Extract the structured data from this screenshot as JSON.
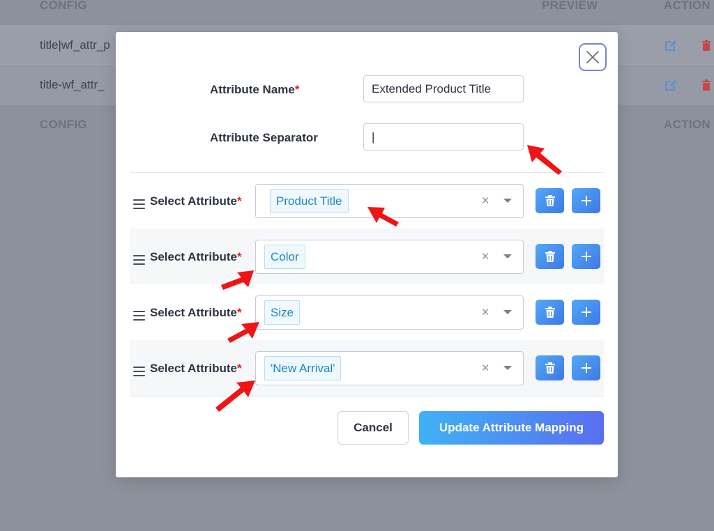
{
  "background_table": {
    "headers": {
      "config": "CONFIG",
      "preview": "PREVIEW",
      "action": "ACTION"
    },
    "rows": [
      {
        "config": "title|wf_attr_p"
      },
      {
        "config": "title-wf_attr_"
      }
    ],
    "footer": {
      "config": "CONFIG",
      "action": "ACTION"
    }
  },
  "modal": {
    "attribute_name": {
      "label": "Attribute Name",
      "required_mark": "*",
      "value": "Extended Product Title"
    },
    "attribute_separator": {
      "label": "Attribute Separator",
      "value": "|"
    },
    "attribute_rows": [
      {
        "label": "Select Attribute",
        "required_mark": "*",
        "selected": "Product Title"
      },
      {
        "label": "Select Attribute",
        "required_mark": "*",
        "selected": "Color"
      },
      {
        "label": "Select Attribute",
        "required_mark": "*",
        "selected": "Size"
      },
      {
        "label": "Select Attribute",
        "required_mark": "*",
        "selected": "'New Arrival'"
      }
    ],
    "clear_glyph": "×",
    "cancel_label": "Cancel",
    "update_label": "Update Attribute Mapping"
  },
  "colors": {
    "overlay": "#8d919b",
    "accent_blue": "#3f78e8",
    "tag_text": "#1d87c3",
    "required_red": "#e0212b",
    "annotation_arrow": "#f01414"
  },
  "icons": {
    "close": "close-icon",
    "drag": "drag-handle-icon",
    "delete": "trash-icon",
    "add": "plus-icon",
    "edit": "edit-icon"
  }
}
